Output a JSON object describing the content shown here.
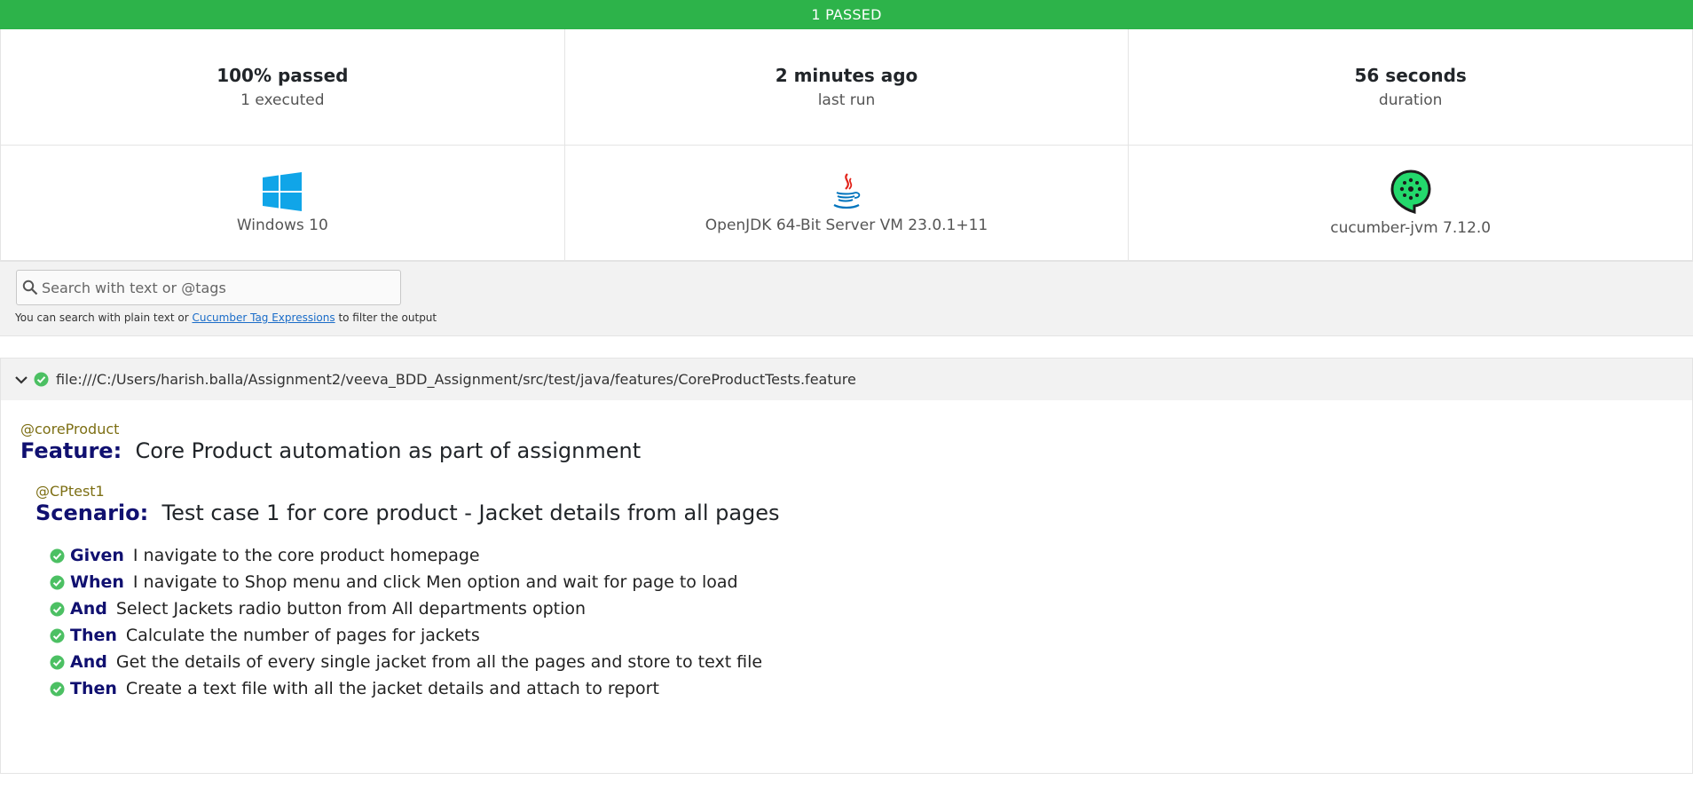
{
  "banner": {
    "label": "1 PASSED",
    "color": "#2db34a"
  },
  "summary": [
    {
      "big": "100% passed",
      "small": "1 executed"
    },
    {
      "big": "2 minutes ago",
      "small": "last run"
    },
    {
      "big": "56 seconds",
      "small": "duration"
    }
  ],
  "environment": [
    {
      "icon": "windows-icon",
      "label": "Windows 10"
    },
    {
      "icon": "java-icon",
      "label": "OpenJDK 64-Bit Server VM 23.0.1+11"
    },
    {
      "icon": "cucumber-icon",
      "label": "cucumber-jvm 7.12.0"
    }
  ],
  "search": {
    "placeholder": "Search with text or @tags",
    "help_prefix": "You can search with plain text or ",
    "help_link": "Cucumber Tag Expressions",
    "help_suffix": " to filter the output"
  },
  "feature": {
    "path": "file:///C:/Users/harish.balla/Assignment2/veeva_BDD_Assignment/src/test/java/features/CoreProductTests.feature",
    "tag": "@coreProduct",
    "keyword": "Feature:",
    "name": "Core Product automation as part of assignment",
    "scenario": {
      "tag": "@CPtest1",
      "keyword": "Scenario:",
      "name": "Test case 1 for core product - Jacket details from all pages",
      "steps": [
        {
          "keyword": "Given",
          "text": "I navigate to the core product homepage"
        },
        {
          "keyword": "When",
          "text": "I navigate to Shop menu and click Men option and wait for page to load"
        },
        {
          "keyword": "And",
          "text": "Select Jackets radio button from All departments option"
        },
        {
          "keyword": "Then",
          "text": "Calculate the number of pages for jackets"
        },
        {
          "keyword": "And",
          "text": "Get the details of every single jacket from all the pages and store to text file"
        },
        {
          "keyword": "Then",
          "text": "Create a text file with all the jacket details and attach to report"
        }
      ]
    }
  }
}
